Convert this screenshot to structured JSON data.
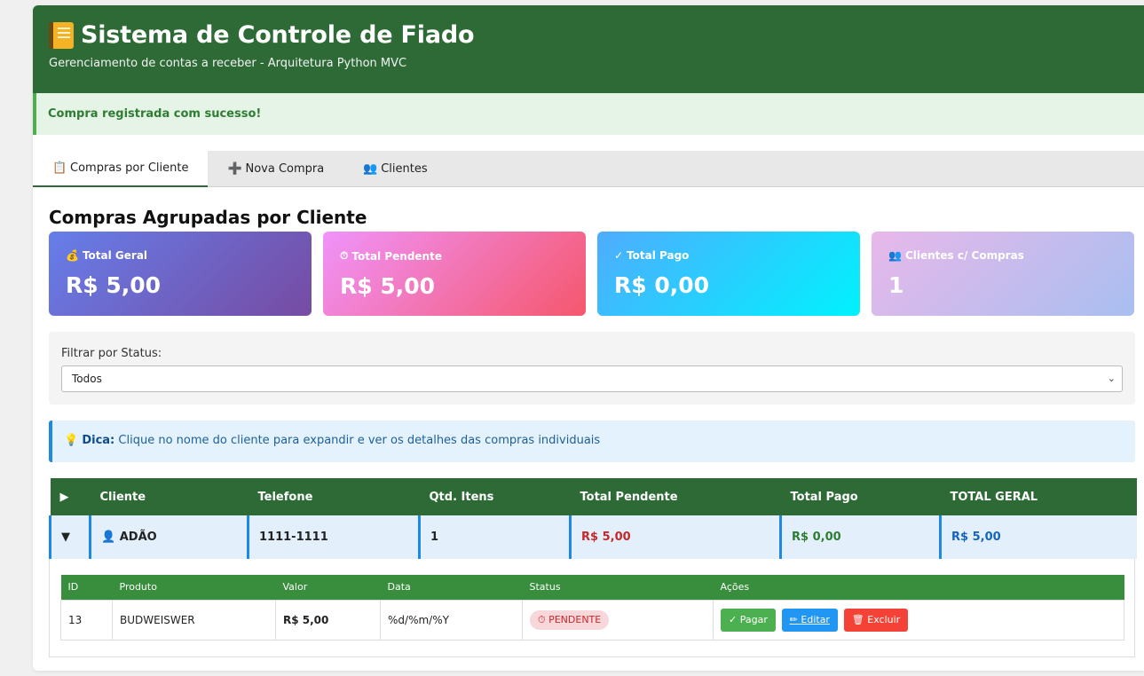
{
  "header": {
    "title": "Sistema de Controle de Fiado",
    "subtitle": "Gerenciamento de contas a receber - Arquitetura Python MVC"
  },
  "alert": {
    "message": "Compra registrada com sucesso!"
  },
  "tabs": [
    {
      "icon": "📋",
      "label": "Compras por Cliente",
      "active": true
    },
    {
      "icon": "➕",
      "label": "Nova Compra",
      "active": false
    },
    {
      "icon": "👥",
      "label": "Clientes",
      "active": false
    }
  ],
  "section": {
    "title": "Compras Agrupadas por Cliente"
  },
  "stats": [
    {
      "icon": "💰",
      "label": "Total Geral",
      "value": "R$ 5,00"
    },
    {
      "icon": "⏱",
      "label": "Total Pendente",
      "value": "R$ 5,00"
    },
    {
      "icon": "✓",
      "label": "Total Pago",
      "value": "R$ 0,00"
    },
    {
      "icon": "👥",
      "label": "Clientes c/ Compras",
      "value": "1"
    }
  ],
  "filter": {
    "label": "Filtrar por Status:",
    "selected": "Todos"
  },
  "tip": {
    "strong": "Dica:",
    "text": " Clique no nome do cliente para expandir e ver os detalhes das compras individuais"
  },
  "group_table": {
    "headers": [
      "▶",
      "Cliente",
      "Telefone",
      "Qtd. Itens",
      "Total Pendente",
      "Total Pago",
      "TOTAL GERAL"
    ],
    "row": {
      "expand": "▼",
      "client": "ADÃO",
      "phone": "1111-1111",
      "qty": "1",
      "pending": "R$ 5,00",
      "paid": "R$ 0,00",
      "total": "R$ 5,00"
    }
  },
  "detail_table": {
    "headers": [
      "ID",
      "Produto",
      "Valor",
      "Data",
      "Status",
      "Ações"
    ],
    "row": {
      "id": "13",
      "product": "BUDWEISWER",
      "value": "R$ 5,00",
      "date": "%d/%m/%Y",
      "status": "PENDENTE",
      "status_icon": "⏱"
    },
    "actions": {
      "pay": "✓ Pagar",
      "edit": "Editar",
      "delete": "Excluir"
    }
  },
  "colors": {
    "header_green": "#2d6a35",
    "pending_red": "#c62828",
    "paid_green": "#2e7d32",
    "total_blue": "#1565c0"
  }
}
